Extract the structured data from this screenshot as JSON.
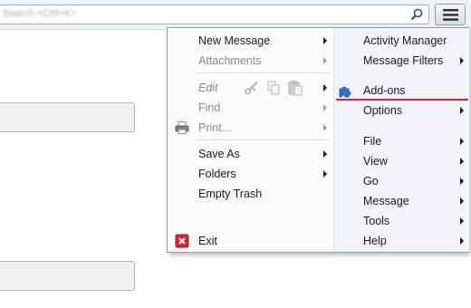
{
  "search": {
    "hint": "Search <Ctrl+K>"
  },
  "toolbar": {
    "menu_button_icon": "hamburger-icon"
  },
  "menu": {
    "left": {
      "new_message": "New Message",
      "attachments": "Attachments",
      "edit": "Edit",
      "find": "Find",
      "print": "Print...",
      "save_as": "Save As",
      "folders": "Folders",
      "empty_trash": "Empty Trash",
      "exit": "Exit"
    },
    "right": {
      "activity_manager": "Activity Manager",
      "message_filters": "Message Filters",
      "addons": "Add-ons",
      "options": "Options",
      "file": "File",
      "view": "View",
      "go": "Go",
      "message": "Message",
      "tools": "Tools",
      "help": "Help"
    }
  },
  "colors": {
    "highlight_underline": "#d8262c",
    "addons_icon": "#2f6fc8",
    "exit_icon": "#d9262c"
  }
}
